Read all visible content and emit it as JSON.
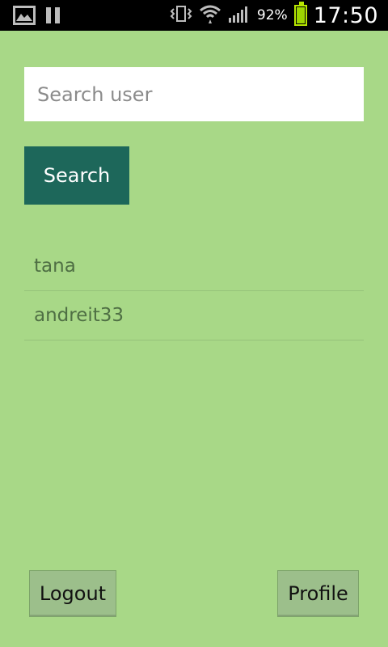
{
  "status_bar": {
    "battery_percent": "92%",
    "time": "17:50",
    "battery_level": 0.92,
    "icons": [
      "image-icon",
      "pause-icon",
      "vibrate-icon",
      "wifi-icon",
      "signal-icon",
      "battery-icon"
    ]
  },
  "search": {
    "placeholder": "Search user",
    "value": "",
    "button_label": "Search"
  },
  "results": [
    {
      "username": "tana"
    },
    {
      "username": "andreit33"
    }
  ],
  "bottom_actions": {
    "logout_label": "Logout",
    "profile_label": "Profile"
  },
  "colors": {
    "background": "#a8d887",
    "primary_button": "#1d675a",
    "secondary_button": "#9cbf8b",
    "list_text": "#4f6f44",
    "status_bar": "#000000"
  }
}
